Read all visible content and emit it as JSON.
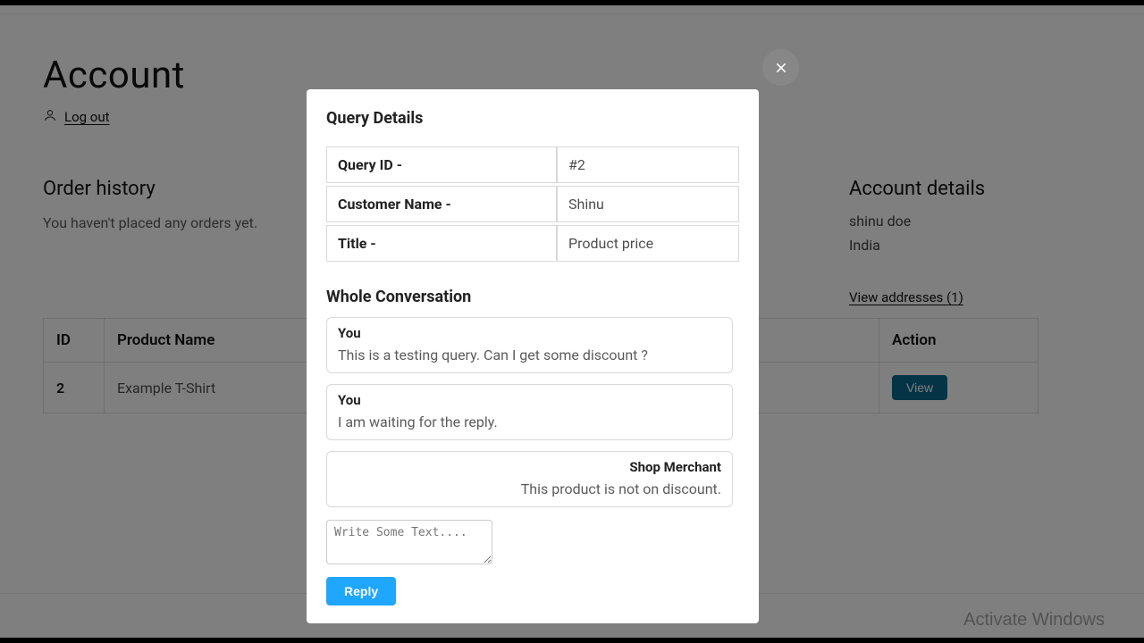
{
  "page": {
    "title": "Account",
    "logout": "Log out",
    "order_history_heading": "Order history",
    "order_history_empty": "You haven't placed any orders yet.",
    "account_details_heading": "Account details",
    "account_name": "shinu doe",
    "account_country": "India",
    "view_addresses": "View addresses (1)"
  },
  "table": {
    "headers": {
      "id": "ID",
      "product": "Product Name",
      "action": "Action"
    },
    "rows": [
      {
        "id": "2",
        "product": "Example T-Shirt",
        "action_label": "View"
      }
    ]
  },
  "modal": {
    "title": "Query Details",
    "fields": {
      "query_id_label": "Query ID -",
      "query_id_value": "#2",
      "customer_label": "Customer Name -",
      "customer_value": "Shinu",
      "title_label": "Title -",
      "title_value": "Product price"
    },
    "conversation_heading": "Whole Conversation",
    "messages": [
      {
        "who": "You",
        "text": "This is a testing query. Can I get some discount ?",
        "align": "left"
      },
      {
        "who": "You",
        "text": "I am waiting for the reply.",
        "align": "left"
      },
      {
        "who": "Shop Merchant",
        "text": "This product is not on discount.",
        "align": "right"
      }
    ],
    "reply_placeholder": "Write Some Text....",
    "reply_button": "Reply"
  },
  "watermark": "Activate Windows"
}
